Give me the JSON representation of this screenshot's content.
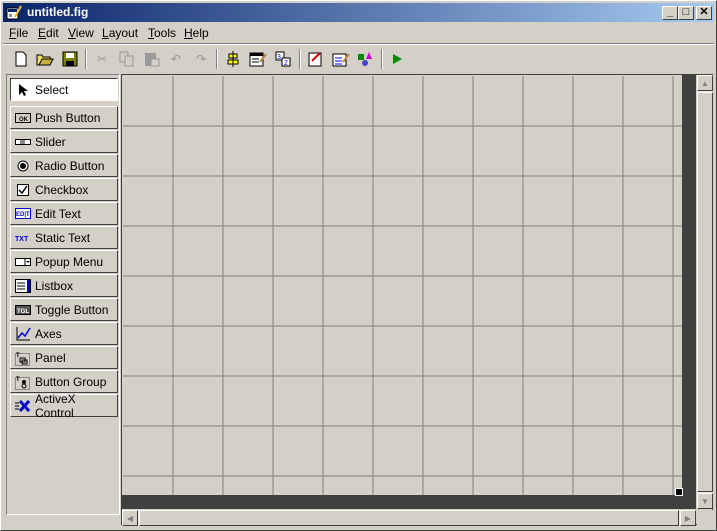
{
  "window": {
    "title": "untitled.fig",
    "controls": {
      "minimize": "_",
      "maximize": "□",
      "close": "✕"
    }
  },
  "menubar": {
    "items": [
      {
        "label": "File",
        "accel": "F",
        "rest": "ile"
      },
      {
        "label": "Edit",
        "accel": "E",
        "rest": "dit"
      },
      {
        "label": "View",
        "accel": "V",
        "rest": "iew"
      },
      {
        "label": "Layout",
        "accel": "L",
        "rest": "ayout"
      },
      {
        "label": "Tools",
        "accel": "T",
        "rest": "ools"
      },
      {
        "label": "Help",
        "accel": "H",
        "rest": "elp"
      }
    ]
  },
  "toolbar": {
    "buttons": [
      {
        "name": "new-icon",
        "enabled": true
      },
      {
        "name": "open-icon",
        "enabled": true
      },
      {
        "name": "save-icon",
        "enabled": true
      },
      {
        "name": "cut-icon",
        "enabled": false
      },
      {
        "name": "copy-icon",
        "enabled": false
      },
      {
        "name": "paste-icon",
        "enabled": false
      },
      {
        "name": "undo-icon",
        "enabled": false
      },
      {
        "name": "redo-icon",
        "enabled": false
      },
      {
        "name": "align-objects-icon",
        "enabled": true
      },
      {
        "name": "menu-editor-icon",
        "enabled": true
      },
      {
        "name": "tab-order-editor-icon",
        "enabled": true
      },
      {
        "name": "mfile-editor-icon",
        "enabled": true
      },
      {
        "name": "property-inspector-icon",
        "enabled": true
      },
      {
        "name": "object-browser-icon",
        "enabled": true
      },
      {
        "name": "run-icon",
        "enabled": true
      }
    ]
  },
  "palette": {
    "items": [
      {
        "label": "Select",
        "icon": "arrow-cursor-icon",
        "selected": true
      },
      {
        "label": "Push Button",
        "icon": "push-button-icon"
      },
      {
        "label": "Slider",
        "icon": "slider-icon"
      },
      {
        "label": "Radio Button",
        "icon": "radio-button-icon"
      },
      {
        "label": "Checkbox",
        "icon": "checkbox-icon"
      },
      {
        "label": "Edit Text",
        "icon": "edit-text-icon"
      },
      {
        "label": "Static Text",
        "icon": "static-text-icon"
      },
      {
        "label": "Popup Menu",
        "icon": "popup-menu-icon"
      },
      {
        "label": "Listbox",
        "icon": "listbox-icon"
      },
      {
        "label": "Toggle Button",
        "icon": "toggle-button-icon"
      },
      {
        "label": "Axes",
        "icon": "axes-icon"
      },
      {
        "label": "Panel",
        "icon": "panel-icon"
      },
      {
        "label": "Button Group",
        "icon": "button-group-icon"
      },
      {
        "label": "ActiveX Control",
        "icon": "activex-icon"
      }
    ],
    "icon_text": {
      "push": "OK",
      "edit": "ED",
      "static": "TXT",
      "toggle": "TGL"
    }
  },
  "colors": {
    "titlebar_start": "#0a246a",
    "titlebar_end": "#a6caf0",
    "face": "#d4d0c8",
    "grid": "#808080",
    "dark": "#404040"
  }
}
